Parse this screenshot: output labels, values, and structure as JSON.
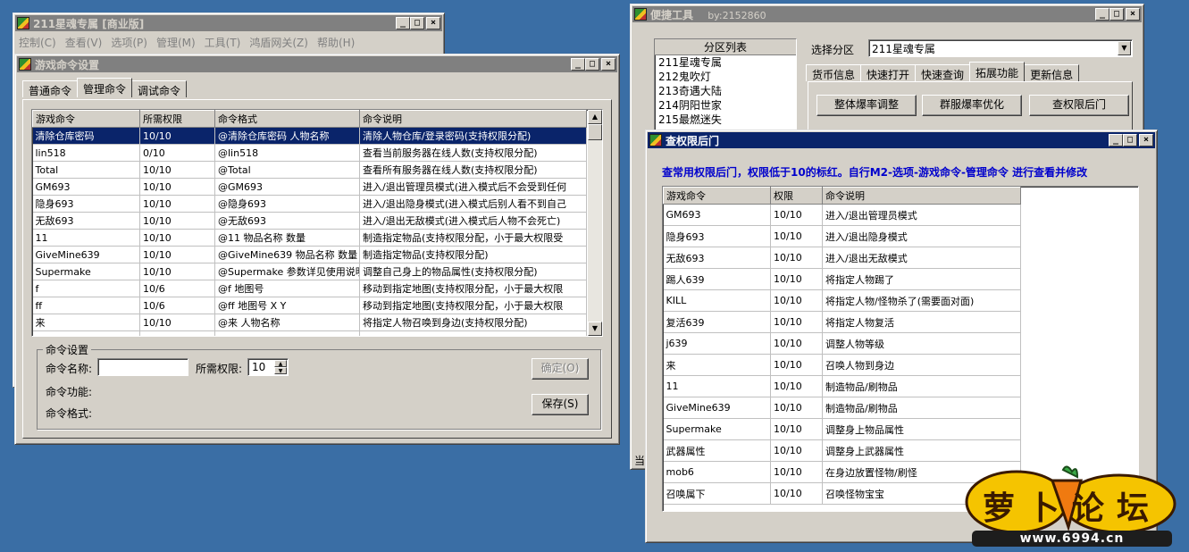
{
  "main_window": {
    "title": "211星魂专属 [商业版]",
    "menu": [
      "控制(C)",
      "查看(V)",
      "选项(P)",
      "管理(M)",
      "工具(T)",
      "鸿盾网关(Z)",
      "帮助(H)"
    ]
  },
  "cmd_window": {
    "title": "游戏命令设置",
    "tabs": [
      "普通命令",
      "管理命令",
      "调试命令"
    ],
    "columns": [
      "游戏命令",
      "所需权限",
      "命令格式",
      "命令说明"
    ],
    "rows": [
      [
        "清除仓库密码",
        "10/10",
        "@清除仓库密码 人物名称",
        "清除人物仓库/登录密码(支持权限分配)"
      ],
      [
        "lin518",
        "0/10",
        "@lin518",
        "查看当前服务器在线人数(支持权限分配)"
      ],
      [
        "Total",
        "10/10",
        "@Total",
        "查看所有服务器在线人数(支持权限分配)"
      ],
      [
        "GM693",
        "10/10",
        "@GM693",
        "进入/退出管理员模式(进入模式后不会受到任何"
      ],
      [
        "隐身693",
        "10/10",
        "@隐身693",
        "进入/退出隐身模式(进入模式后别人看不到自己"
      ],
      [
        "无敌693",
        "10/10",
        "@无敌693",
        "进入/退出无敌模式(进入模式后人物不会死亡)"
      ],
      [
        "11",
        "10/10",
        "@11 物品名称 数量",
        "制造指定物品(支持权限分配，小于最大权限受"
      ],
      [
        "GiveMine639",
        "10/10",
        "@GiveMine639 物品名称 数量",
        "制造指定物品(支持权限分配)"
      ],
      [
        "Supermake",
        "10/10",
        "@Supermake 参数详见使用说明",
        "调整自己身上的物品属性(支持权限分配)"
      ],
      [
        "f",
        "10/6",
        "@f 地图号",
        "移动到指定地图(支持权限分配，小于最大权限"
      ],
      [
        "ff",
        "10/6",
        "@ff 地图号 X Y",
        "移动到指定地图(支持权限分配，小于最大权限"
      ],
      [
        "来",
        "10/10",
        "@来 人物名称",
        "将指定人物召唤到身边(支持权限分配)"
      ]
    ],
    "group_title": "命令设置",
    "name_label": "命令名称:",
    "perm_label": "所需权限:",
    "perm_value": "10",
    "func_label": "命令功能:",
    "format_label": "命令格式:",
    "ok_label": "确定(O)",
    "save_label": "保存(S)"
  },
  "tool_window": {
    "title": "便捷工具",
    "author": "by:2152860",
    "list_header": "分区列表",
    "list_items": [
      "211星魂专属",
      "212鬼吹灯",
      "213奇遇大陆",
      "214阴阳世家",
      "215最燃迷失"
    ],
    "select_label": "选择分区",
    "select_value": "211星魂专属",
    "tabs": [
      "货币信息",
      "快速打开",
      "快速查询",
      "拓展功能",
      "更新信息"
    ],
    "buttons": [
      "整体爆率调整",
      "群服爆率优化",
      "查权限后门"
    ],
    "status_char": "当"
  },
  "perm_window": {
    "title": "查权限后门",
    "notice": "查常用权限后门，权限低于10的标红。自行M2-选项-游戏命令-管理命令 进行查看并修改",
    "columns": [
      "游戏命令",
      "权限",
      "命令说明"
    ],
    "rows": [
      [
        "GM693",
        "10/10",
        "进入/退出管理员模式"
      ],
      [
        "隐身693",
        "10/10",
        "进入/退出隐身模式"
      ],
      [
        "无敌693",
        "10/10",
        "进入/退出无敌模式"
      ],
      [
        "踢人639",
        "10/10",
        "将指定人物踢了"
      ],
      [
        "KILL",
        "10/10",
        "将指定人物/怪物杀了(需要面对面)"
      ],
      [
        "复活639",
        "10/10",
        "将指定人物复活"
      ],
      [
        "j639",
        "10/10",
        "调整人物等级"
      ],
      [
        "来",
        "10/10",
        "召唤人物到身边"
      ],
      [
        "11",
        "10/10",
        "制造物品/刷物品"
      ],
      [
        "GiveMine639",
        "10/10",
        "制造物品/刷物品"
      ],
      [
        "Supermake",
        "10/10",
        "调整身上物品属性"
      ],
      [
        "武器属性",
        "10/10",
        "调整身上武器属性"
      ],
      [
        "mob6",
        "10/10",
        "在身边放置怪物/刷怪"
      ],
      [
        "召唤属下",
        "10/10",
        "召唤怪物宝宝"
      ]
    ]
  },
  "watermark": {
    "text": "萝卜论坛",
    "url": "www.6994.cn"
  }
}
